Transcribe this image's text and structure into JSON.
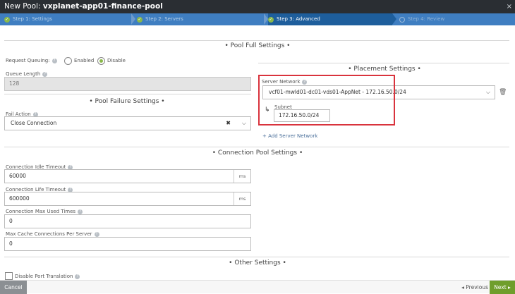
{
  "window": {
    "title_prefix": "New Pool: ",
    "title_name": "vxplanet-app01-finance-pool"
  },
  "steps": [
    {
      "label": "Step 1: Settings",
      "state": "done"
    },
    {
      "label": "Step 2: Servers",
      "state": "done"
    },
    {
      "label": "Step 3: Advanced",
      "state": "active"
    },
    {
      "label": "Step 4: Review",
      "state": "pending"
    }
  ],
  "pool_full": {
    "title": "• Pool Full Settings •",
    "request_queuing_label": "Request Queuing:",
    "enabled_label": "Enabled",
    "disable_label": "Disable",
    "selected": "Disable",
    "queue_length_label": "Queue Length",
    "queue_length_value": "128"
  },
  "pool_failure": {
    "title": "• Pool Failure Settings •",
    "fail_action_label": "Fail Action",
    "fail_action_value": "Close Connection"
  },
  "placement": {
    "title": "• Placement Settings •",
    "server_network_label": "Server Network",
    "server_network_value": "vcf01-mwld01-dc01-vds01-AppNet - 172.16.50.0/24",
    "subnet_label": "Subnet",
    "subnet_value": "172.16.50.0/24",
    "add_server_network": "+ Add Server Network"
  },
  "connection_pool": {
    "title": "• Connection Pool Settings •",
    "idle_timeout_label": "Connection Idle Timeout",
    "idle_timeout_value": "60000",
    "idle_timeout_unit": "ms",
    "life_timeout_label": "Connection Life Timeout",
    "life_timeout_value": "600000",
    "life_timeout_unit": "ms",
    "max_used_label": "Connection Max Used Times",
    "max_used_value": "0",
    "max_cache_label": "Max Cache Connections Per Server",
    "max_cache_value": "0"
  },
  "other": {
    "title": "• Other Settings •",
    "disable_port_translation_label": "Disable Port Translation"
  },
  "footer": {
    "cancel": "Cancel",
    "previous": "◂ Previous",
    "next": "Next ▸"
  },
  "colors": {
    "accent": "#3f7ec1",
    "active_step": "#1e5e9c",
    "success": "#8ab84a",
    "highlight": "#d9333d"
  }
}
